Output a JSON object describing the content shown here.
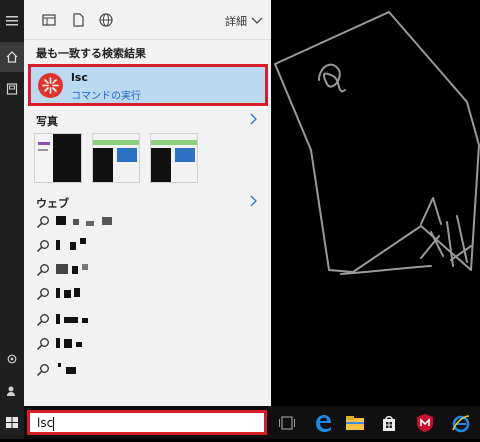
{
  "toolbar": {
    "detail_label": "詳細"
  },
  "best_match": {
    "section_title": "最も一致する検索結果",
    "name": "lsc",
    "subtitle": "コマンドの実行"
  },
  "photos": {
    "section_title": "写真",
    "count": 3
  },
  "web": {
    "section_title": "ウェブ",
    "items": [
      "",
      "",
      "",
      "",
      "",
      "",
      ""
    ]
  },
  "search": {
    "value": "lsc"
  },
  "colors": {
    "accent_red": "#d81e2a",
    "selection_blue": "#bcd9f2",
    "link_blue": "#1a64c6"
  },
  "icons": {
    "rail": [
      "hamburger-icon",
      "home-icon",
      "notebook-icon",
      "settings-icon",
      "feedback-icon",
      "windows-icon"
    ],
    "toolbar": [
      "apps-icon",
      "documents-icon",
      "web-globe-icon",
      "chevron-down-icon"
    ],
    "taskbar": [
      "task-view-icon",
      "edge-icon",
      "file-explorer-icon",
      "store-icon",
      "mcafee-icon",
      "ie-icon"
    ]
  }
}
